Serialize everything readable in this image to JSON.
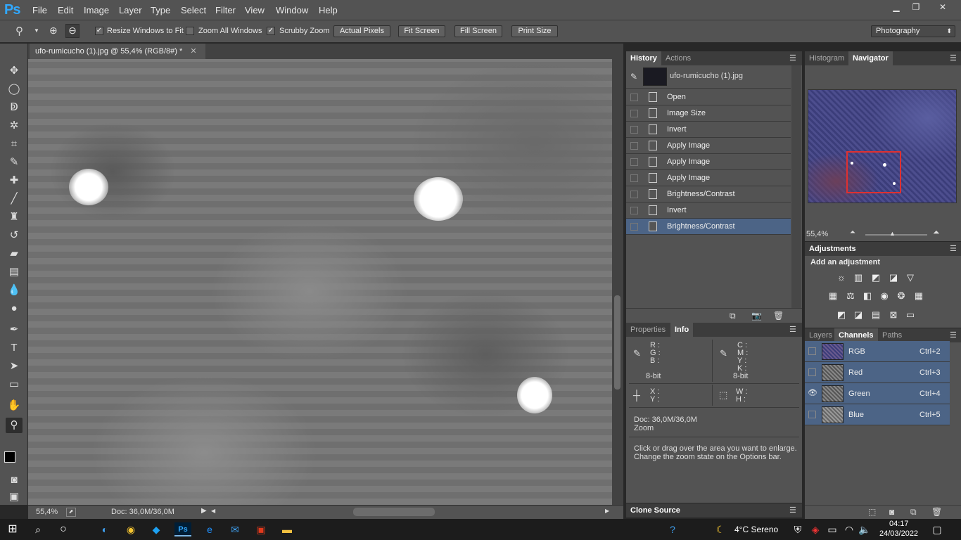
{
  "app": {
    "logo": "Ps"
  },
  "menu": [
    "File",
    "Edit",
    "Image",
    "Layer",
    "Type",
    "Select",
    "Filter",
    "View",
    "Window",
    "Help"
  ],
  "window_controls": {
    "minimize": "▁",
    "restore": "❐",
    "close": "✕"
  },
  "options": {
    "resize_windows": {
      "label": "Resize Windows to Fit",
      "checked": true
    },
    "zoom_all": {
      "label": "Zoom All Windows",
      "checked": false
    },
    "scrubby": {
      "label": "Scrubby Zoom",
      "checked": true
    },
    "buttons": [
      "Actual Pixels",
      "Fit Screen",
      "Fill Screen",
      "Print Size"
    ],
    "workspace": "Photography"
  },
  "document": {
    "tab_title": "ufo-rumicucho (1).jpg @ 55,4% (RGB/8#) *"
  },
  "status": {
    "zoom": "55,4%",
    "doc": "Doc: 36,0M/36,0M"
  },
  "history": {
    "tabs": [
      "History",
      "Actions"
    ],
    "snapshot": "ufo-rumicucho (1).jpg",
    "items": [
      {
        "label": "Open",
        "selected": false
      },
      {
        "label": "Image Size",
        "selected": false
      },
      {
        "label": "Invert",
        "selected": false
      },
      {
        "label": "Apply Image",
        "selected": false
      },
      {
        "label": "Apply Image",
        "selected": false
      },
      {
        "label": "Apply Image",
        "selected": false
      },
      {
        "label": "Brightness/Contrast",
        "selected": false
      },
      {
        "label": "Invert",
        "selected": false
      },
      {
        "label": "Brightness/Contrast",
        "selected": true
      }
    ]
  },
  "info": {
    "tabs": [
      "Properties",
      "Info"
    ],
    "rgb": [
      "R :",
      "G :",
      "B :"
    ],
    "cmyk": [
      "C :",
      "M :",
      "Y :",
      "K :"
    ],
    "bit_left": "8-bit",
    "bit_right": "8-bit",
    "xy": [
      "X :",
      "Y :"
    ],
    "wh": [
      "W :",
      "H :"
    ],
    "doc": "Doc: 36,0M/36,0M",
    "tool": "Zoom",
    "hint1": "Click or drag over the area you want to enlarge.",
    "hint2": "Change the zoom state on the Options bar."
  },
  "clone_source": "Clone Source",
  "navigator": {
    "tabs": [
      "Histogram",
      "Navigator"
    ],
    "zoom": "55,4%"
  },
  "adjustments": {
    "title": "Adjustments",
    "subtitle": "Add an adjustment"
  },
  "channels": {
    "tabs": [
      "Layers",
      "Channels",
      "Paths"
    ],
    "rows": [
      {
        "name": "RGB",
        "shortcut": "Ctrl+2",
        "visible": false
      },
      {
        "name": "Red",
        "shortcut": "Ctrl+3",
        "visible": false
      },
      {
        "name": "Green",
        "shortcut": "Ctrl+4",
        "visible": true
      },
      {
        "name": "Blue",
        "shortcut": "Ctrl+5",
        "visible": false
      }
    ]
  },
  "taskbar": {
    "weather": "4°C Sereno",
    "time": "04:17",
    "date": "24/03/2022"
  }
}
